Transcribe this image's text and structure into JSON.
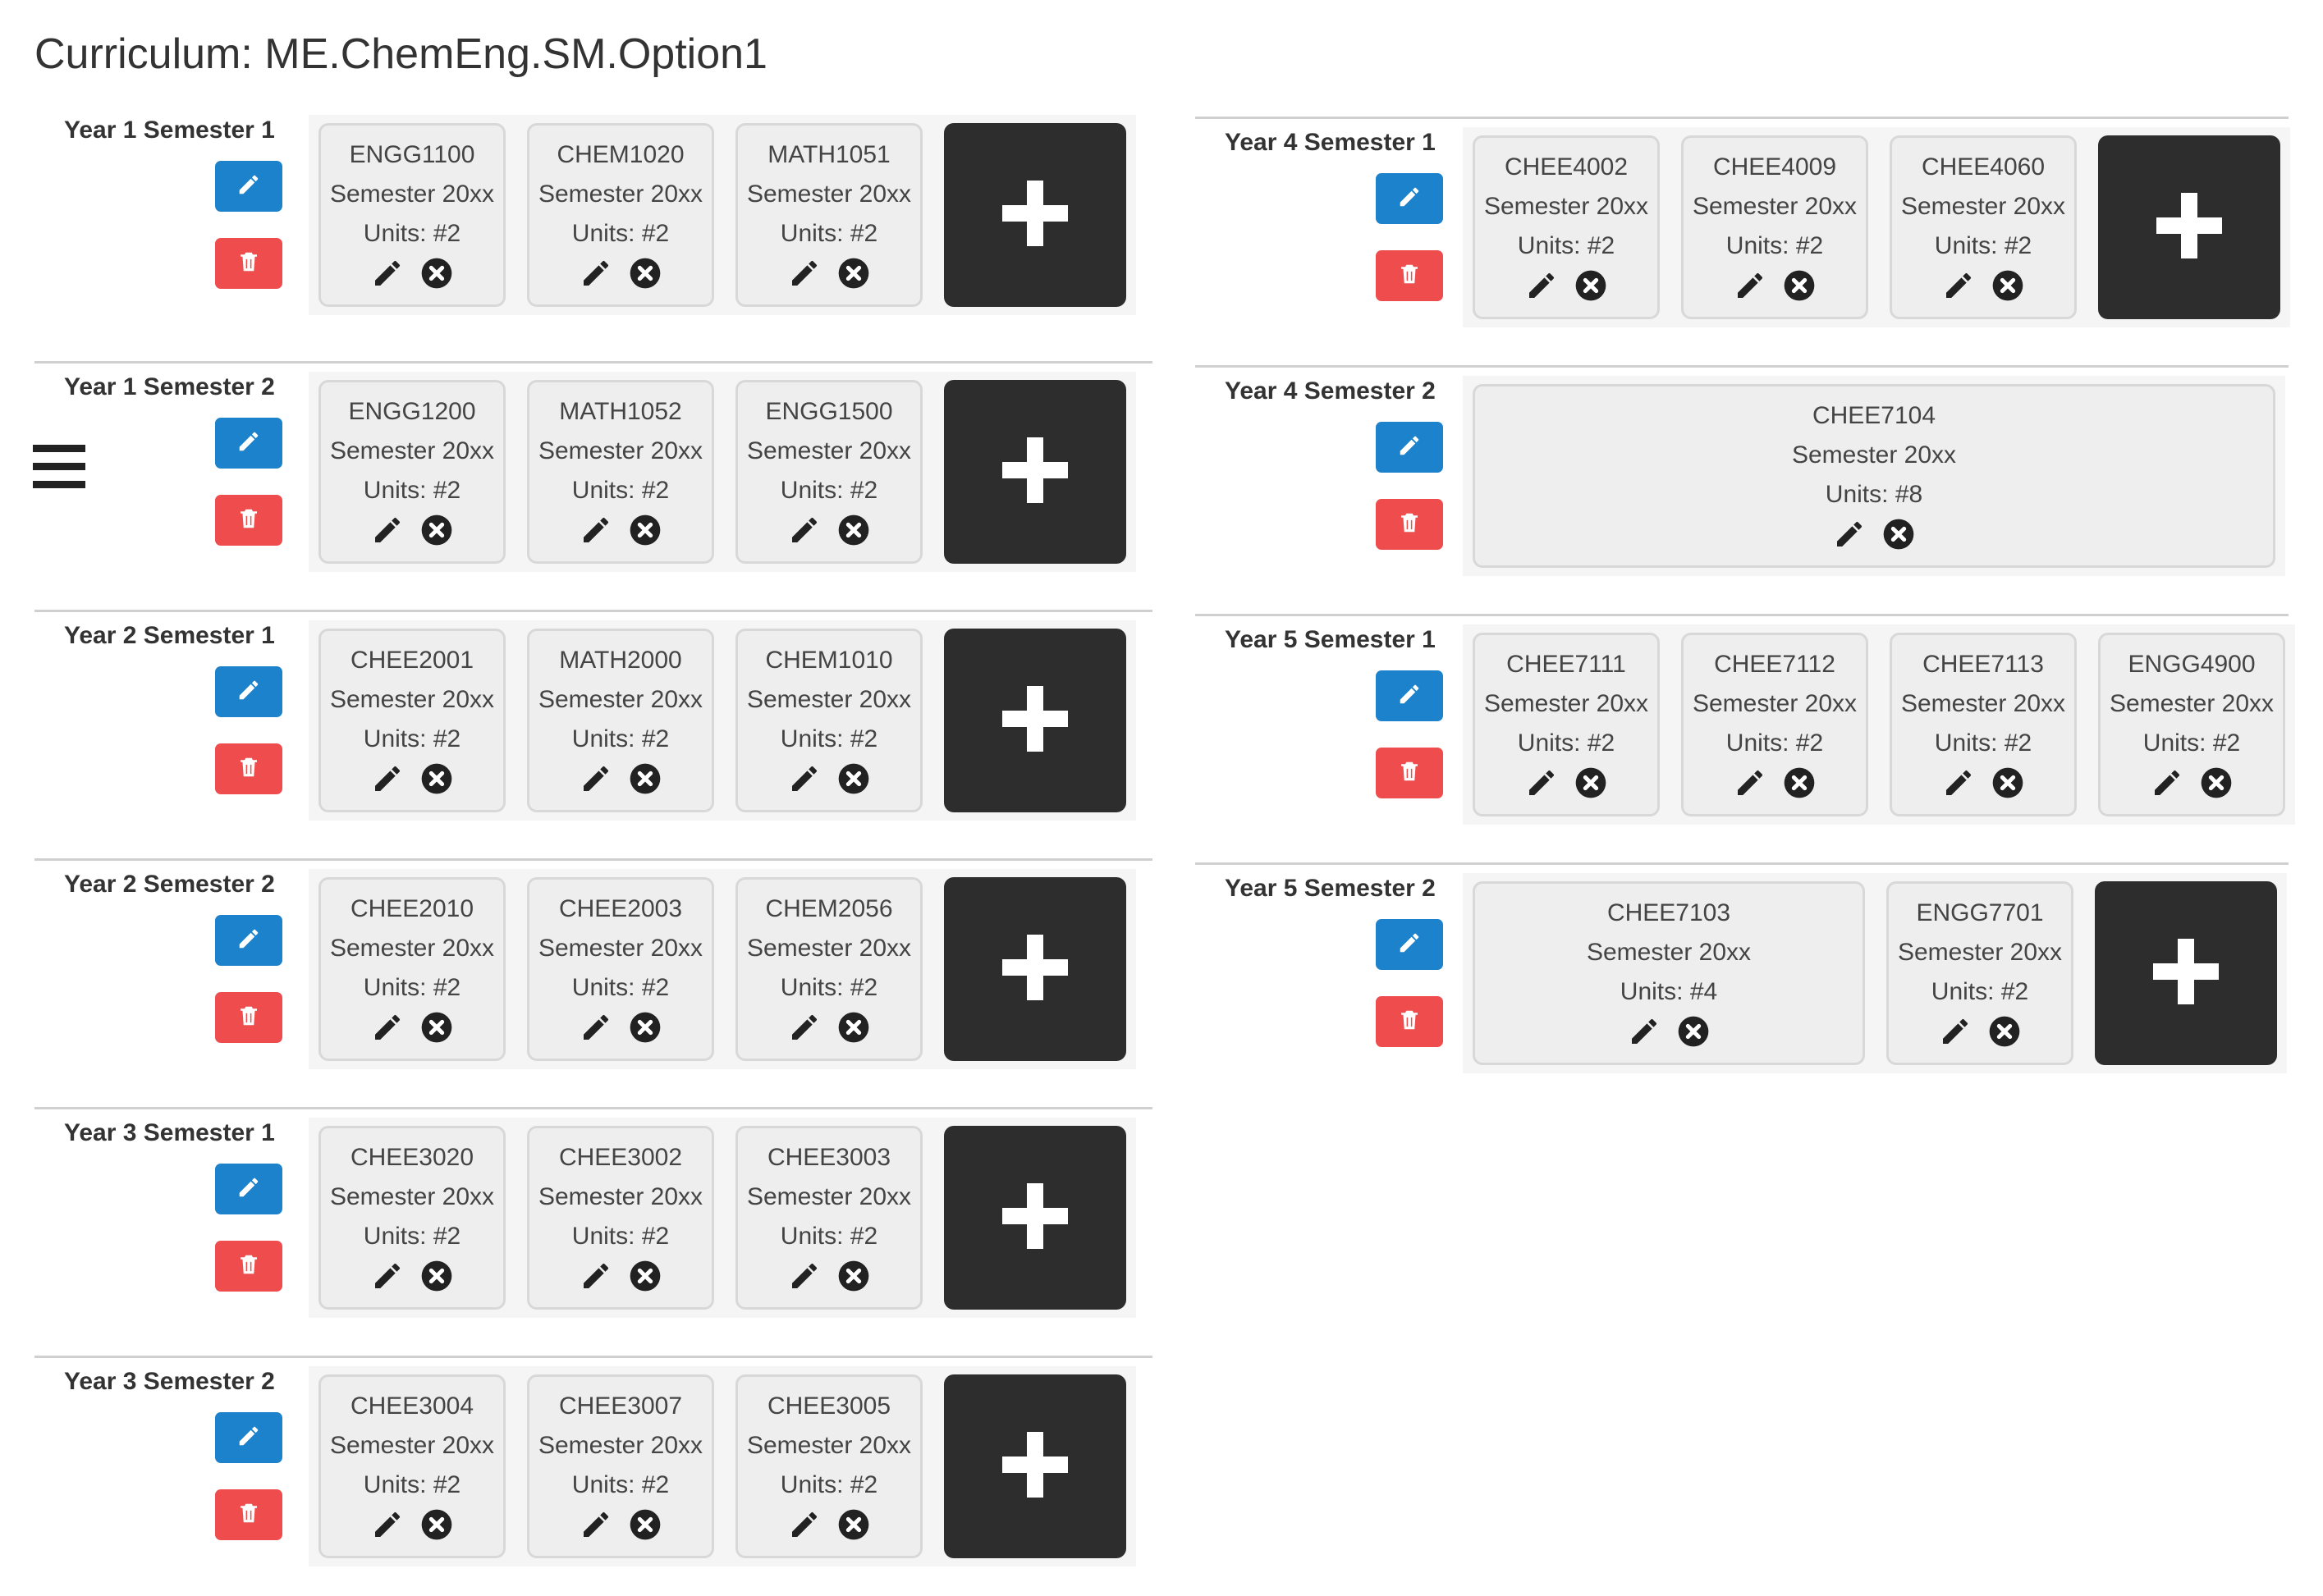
{
  "page": {
    "title": "Curriculum: ME.ChemEng.SM.Option1"
  },
  "icons": {
    "menu": "hamburger-icon",
    "edit": "pencil-icon",
    "delete": "trash-icon",
    "remove": "remove-circle-icon",
    "add": "plus-icon"
  },
  "colors": {
    "edit_button": "#1d82cc",
    "delete_button": "#ef4d4d",
    "add_tile": "#2d2d2d",
    "course_bg": "#eeeeee"
  },
  "semesters": [
    {
      "label": "Year 1 Semester 1",
      "courses": [
        {
          "code": "ENGG1100",
          "semester": "Semester 20xx",
          "units": "Units: #2"
        },
        {
          "code": "CHEM1020",
          "semester": "Semester 20xx",
          "units": "Units: #2"
        },
        {
          "code": "MATH1051",
          "semester": "Semester 20xx",
          "units": "Units: #2"
        }
      ]
    },
    {
      "label": "Year 1 Semester 2",
      "courses": [
        {
          "code": "ENGG1200",
          "semester": "Semester 20xx",
          "units": "Units: #2"
        },
        {
          "code": "MATH1052",
          "semester": "Semester 20xx",
          "units": "Units: #2"
        },
        {
          "code": "ENGG1500",
          "semester": "Semester 20xx",
          "units": "Units: #2"
        }
      ]
    },
    {
      "label": "Year 2 Semester 1",
      "courses": [
        {
          "code": "CHEE2001",
          "semester": "Semester 20xx",
          "units": "Units: #2"
        },
        {
          "code": "MATH2000",
          "semester": "Semester 20xx",
          "units": "Units: #2"
        },
        {
          "code": "CHEM1010",
          "semester": "Semester 20xx",
          "units": "Units: #2"
        }
      ]
    },
    {
      "label": "Year 2 Semester 2",
      "courses": [
        {
          "code": "CHEE2010",
          "semester": "Semester 20xx",
          "units": "Units: #2"
        },
        {
          "code": "CHEE2003",
          "semester": "Semester 20xx",
          "units": "Units: #2"
        },
        {
          "code": "CHEM2056",
          "semester": "Semester 20xx",
          "units": "Units: #2"
        }
      ]
    },
    {
      "label": "Year 3 Semester 1",
      "courses": [
        {
          "code": "CHEE3020",
          "semester": "Semester 20xx",
          "units": "Units: #2"
        },
        {
          "code": "CHEE3002",
          "semester": "Semester 20xx",
          "units": "Units: #2"
        },
        {
          "code": "CHEE3003",
          "semester": "Semester 20xx",
          "units": "Units: #2"
        }
      ]
    },
    {
      "label": "Year 3 Semester 2",
      "courses": [
        {
          "code": "CHEE3004",
          "semester": "Semester 20xx",
          "units": "Units: #2"
        },
        {
          "code": "CHEE3007",
          "semester": "Semester 20xx",
          "units": "Units: #2"
        },
        {
          "code": "CHEE3005",
          "semester": "Semester 20xx",
          "units": "Units: #2"
        }
      ]
    },
    {
      "label": "Year 4 Semester 1",
      "courses": [
        {
          "code": "CHEE4002",
          "semester": "Semester 20xx",
          "units": "Units: #2"
        },
        {
          "code": "CHEE4009",
          "semester": "Semester 20xx",
          "units": "Units: #2"
        },
        {
          "code": "CHEE4060",
          "semester": "Semester 20xx",
          "units": "Units: #2"
        }
      ]
    },
    {
      "label": "Year 4 Semester 2",
      "courses": [
        {
          "code": "CHEE7104",
          "semester": "Semester 20xx",
          "units": "Units: #8"
        }
      ]
    },
    {
      "label": "Year 5 Semester 1",
      "courses": [
        {
          "code": "CHEE7111",
          "semester": "Semester 20xx",
          "units": "Units: #2"
        },
        {
          "code": "CHEE7112",
          "semester": "Semester 20xx",
          "units": "Units: #2"
        },
        {
          "code": "CHEE7113",
          "semester": "Semester 20xx",
          "units": "Units: #2"
        },
        {
          "code": "ENGG4900",
          "semester": "Semester 20xx",
          "units": "Units: #2"
        }
      ]
    },
    {
      "label": "Year 5 Semester 2",
      "courses": [
        {
          "code": "CHEE7103",
          "semester": "Semester 20xx",
          "units": "Units: #4"
        },
        {
          "code": "ENGG7701",
          "semester": "Semester 20xx",
          "units": "Units: #2"
        }
      ]
    }
  ]
}
